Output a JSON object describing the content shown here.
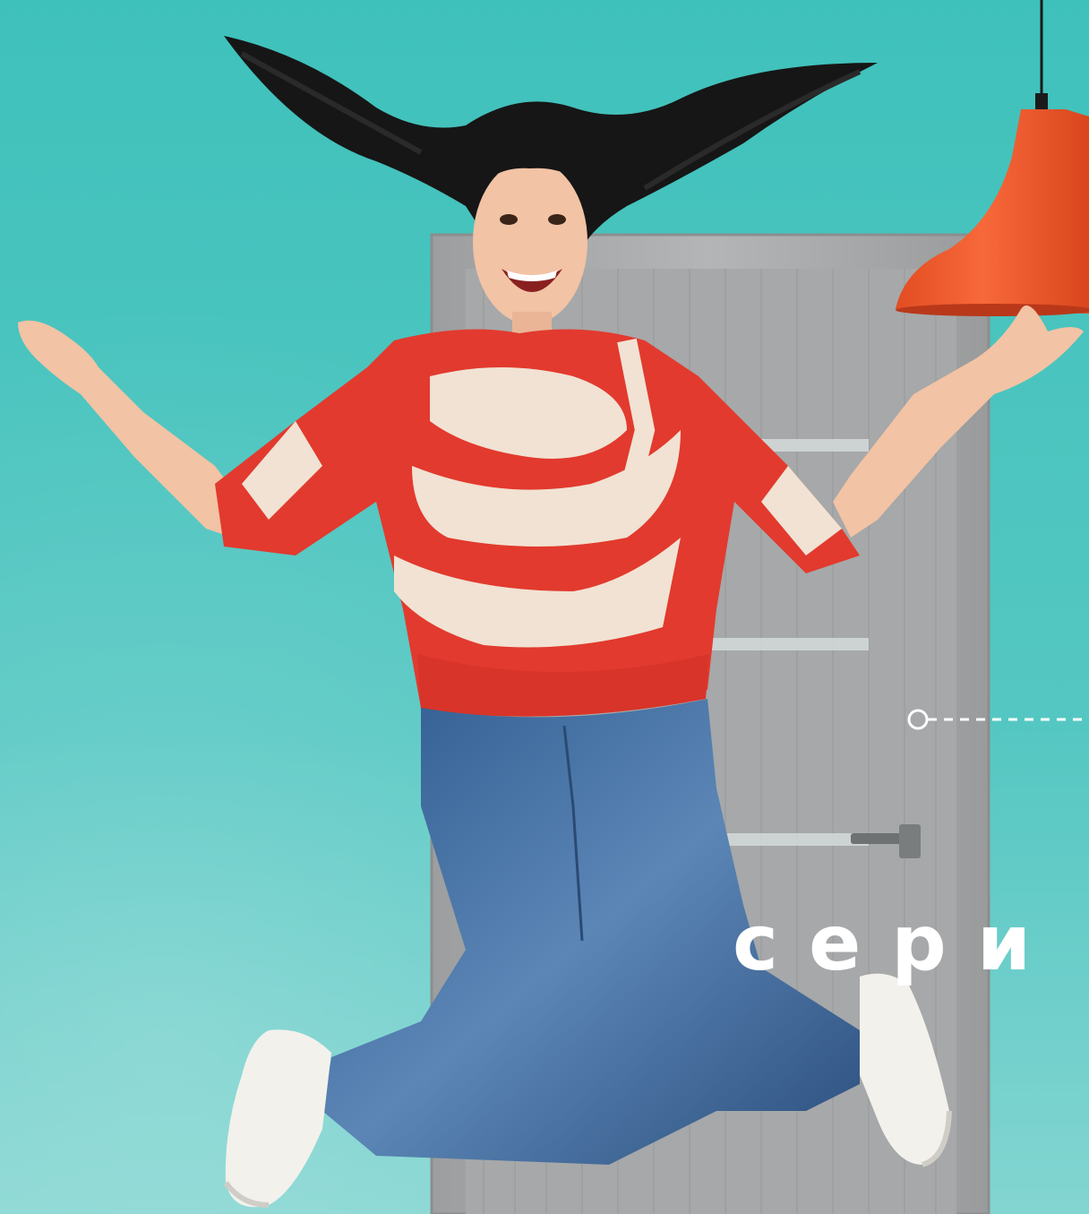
{
  "banner": {
    "headline_fragment": "сери"
  },
  "colors": {
    "background_top": "#3fc1bb",
    "background_bottom": "#7fd3cf",
    "door_gray": "#a8aaab",
    "lamp_orange": "#f25a2d",
    "sweater_red": "#e23a2e",
    "sweater_cream": "#f1e2d3",
    "jeans_blue": "#3f6a9c",
    "hair_black": "#161616",
    "skin": "#f2c3a4",
    "text_white": "#ffffff"
  }
}
